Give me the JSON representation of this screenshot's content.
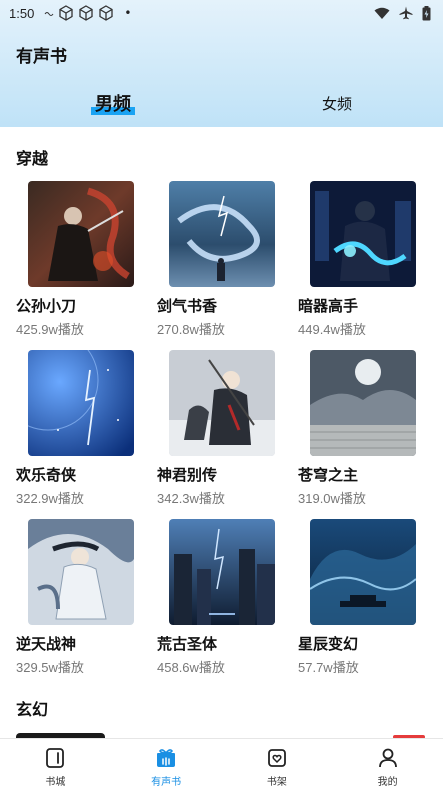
{
  "status_bar": {
    "time": "1:50",
    "dot": "•"
  },
  "header": {
    "app_title": "有声书"
  },
  "gender_tabs": [
    {
      "label": "男频",
      "active": true
    },
    {
      "label": "女频",
      "active": false
    }
  ],
  "sections": [
    {
      "title": "穿越",
      "books": [
        {
          "title": "公孙小刀",
          "plays": "425.9w播放",
          "cover": "warrior-red-dragon"
        },
        {
          "title": "剑气书香",
          "plays": "270.8w播放",
          "cover": "storm-dragon"
        },
        {
          "title": "暗器高手",
          "plays": "449.4w播放",
          "cover": "blue-lightning-hero"
        },
        {
          "title": "欢乐奇侠",
          "plays": "322.9w播放",
          "cover": "blue-moon-lightning"
        },
        {
          "title": "神君别传",
          "plays": "342.3w播放",
          "cover": "snow-warrior"
        },
        {
          "title": "苍穹之主",
          "plays": "319.0w播放",
          "cover": "moonlit-clouds"
        },
        {
          "title": "逆天战神",
          "plays": "329.5w播放",
          "cover": "white-robed-swordsman"
        },
        {
          "title": "荒古圣体",
          "plays": "458.6w播放",
          "cover": "storm-city"
        },
        {
          "title": "星辰变幻",
          "plays": "57.7w播放",
          "cover": "ocean-wave"
        }
      ]
    },
    {
      "title": "玄幻"
    }
  ],
  "bottom_nav": [
    {
      "label": "书城",
      "icon": "book-city-icon",
      "active": false
    },
    {
      "label": "有声书",
      "icon": "gift-audio-icon",
      "active": true
    },
    {
      "label": "书架",
      "icon": "bookshelf-heart-icon",
      "active": false
    },
    {
      "label": "我的",
      "icon": "person-icon",
      "active": false
    }
  ],
  "colors": {
    "accent": "#1aa3f3",
    "nav_active": "#1a8fe3",
    "header_gradient_top": "#e4f2fb",
    "header_gradient_bottom": "#bfe2f7"
  }
}
